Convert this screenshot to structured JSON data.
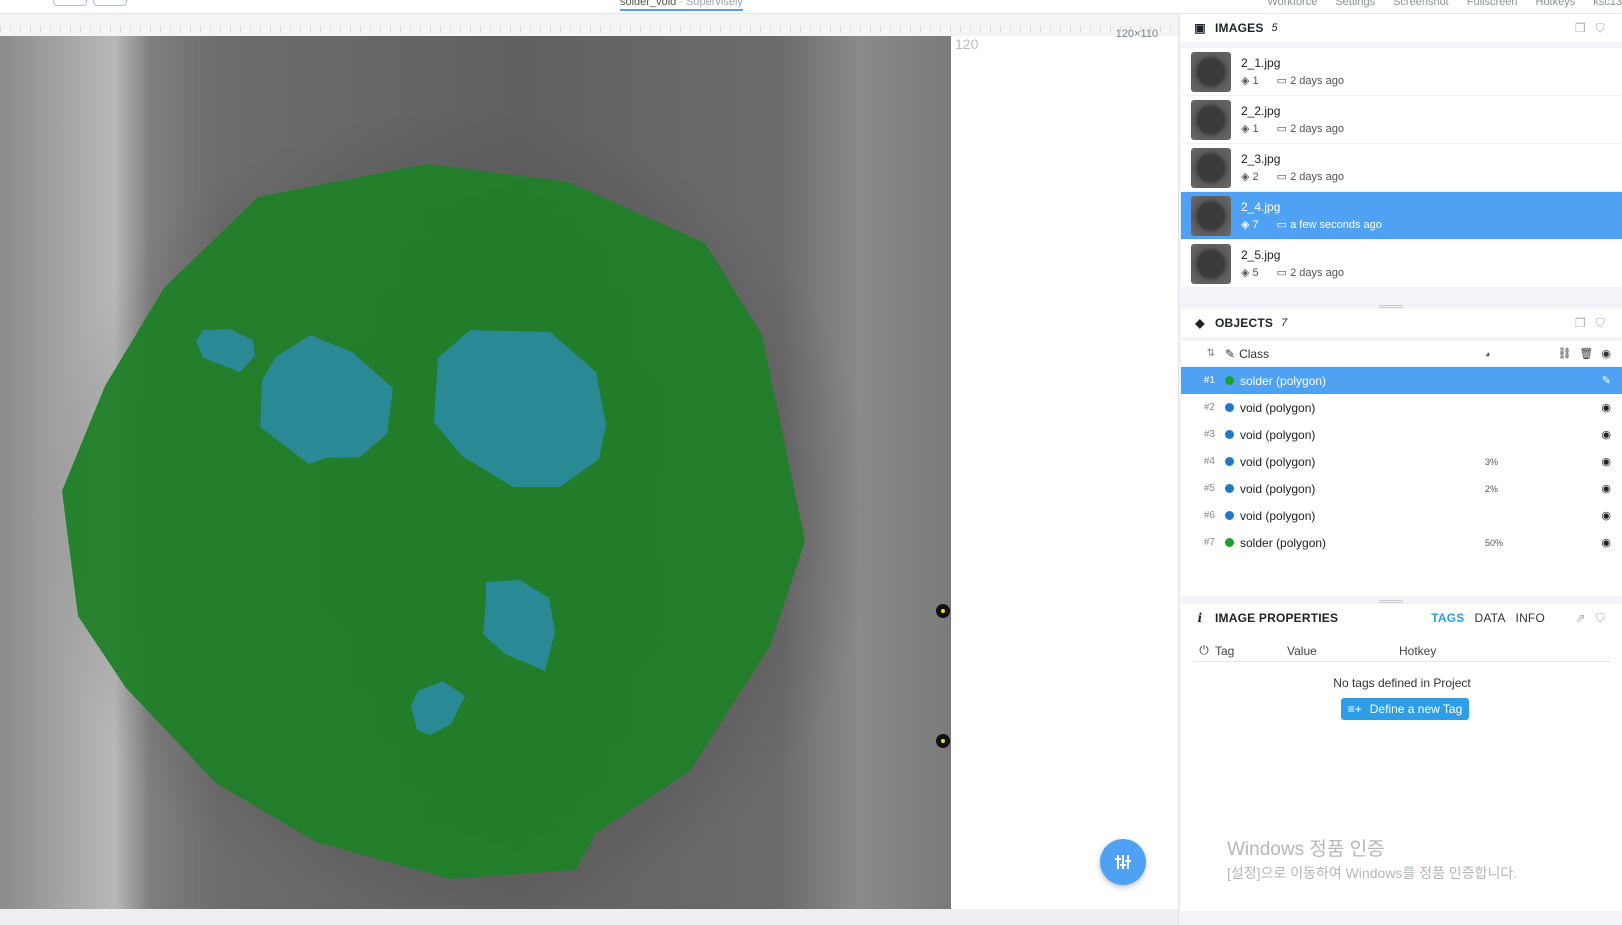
{
  "document": {
    "title": "solder_void",
    "subtitle": "· Supervisely"
  },
  "top_menu": [
    "Workforce",
    "Settings",
    "Screenshot",
    "Fullscreen",
    "Hotkeys",
    "ksc13"
  ],
  "canvas": {
    "ruler_mark": "120",
    "image_size": "120×110"
  },
  "images": {
    "title": "IMAGES",
    "count": "5",
    "items": [
      {
        "name": "2_1.jpg",
        "objects": "1",
        "date": "2 days ago",
        "active": false
      },
      {
        "name": "2_2.jpg",
        "objects": "1",
        "date": "2 days ago",
        "active": false
      },
      {
        "name": "2_3.jpg",
        "objects": "2",
        "date": "2 days ago",
        "active": false
      },
      {
        "name": "2_4.jpg",
        "objects": "7",
        "date": "a few seconds ago",
        "active": true
      },
      {
        "name": "2_5.jpg",
        "objects": "5",
        "date": "2 days ago",
        "active": false
      }
    ]
  },
  "objects": {
    "title": "OBJECTS",
    "count": "7",
    "header_class": "Class",
    "rows": [
      {
        "id": "#1",
        "label": "solder (polygon)",
        "color": "#1aa32a",
        "area": "",
        "active": true
      },
      {
        "id": "#2",
        "label": "void (polygon)",
        "color": "#1f78c8",
        "area": "",
        "active": false
      },
      {
        "id": "#3",
        "label": "void (polygon)",
        "color": "#1f78c8",
        "area": "",
        "active": false
      },
      {
        "id": "#4",
        "label": "void (polygon)",
        "color": "#1f78c8",
        "area": "3%",
        "active": false
      },
      {
        "id": "#5",
        "label": "void (polygon)",
        "color": "#1f78c8",
        "area": "2%",
        "active": false
      },
      {
        "id": "#6",
        "label": "void (polygon)",
        "color": "#1f78c8",
        "area": "",
        "active": false
      },
      {
        "id": "#7",
        "label": "solder (polygon)",
        "color": "#1aa32a",
        "area": "50%",
        "active": false
      }
    ]
  },
  "properties": {
    "title": "IMAGE PROPERTIES",
    "tabs": [
      "TAGS",
      "DATA",
      "INFO"
    ],
    "columns": {
      "tag": "Tag",
      "value": "Value",
      "hotkey": "Hotkey"
    },
    "empty_text": "No tags defined in Project",
    "define_button": "Define a new Tag"
  },
  "watermark": {
    "line1": "Windows 정품 인증",
    "line2": "[설정]으로 이동하여 Windows를 정품 인증합니다."
  },
  "colors": {
    "accent": "#4ea1f3",
    "solder": "#1f7f27",
    "void": "#2a8a9a"
  }
}
